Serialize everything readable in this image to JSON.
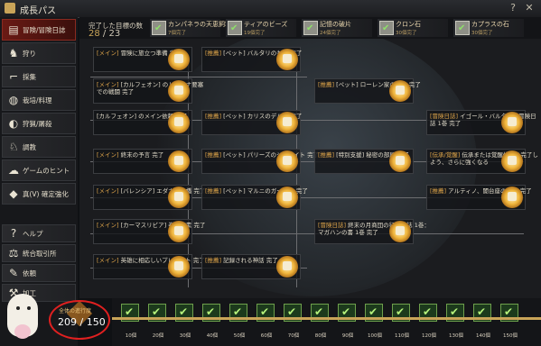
{
  "window": {
    "title": "成長パス"
  },
  "sidebar": {
    "items": [
      {
        "label": "冒険/冒険日誌",
        "icon": "book-icon"
      },
      {
        "label": "狩り",
        "icon": "boar-icon"
      },
      {
        "label": "採集",
        "icon": "hoe-icon"
      },
      {
        "label": "栽培/料理",
        "icon": "cooking-icon"
      },
      {
        "label": "狩猟/屠殺",
        "icon": "hunting-icon"
      },
      {
        "label": "調教",
        "icon": "horse-icon"
      },
      {
        "label": "ゲームのヒント",
        "icon": "hint-icon"
      },
      {
        "label": "真(V) 確定強化",
        "icon": "enhance-icon"
      }
    ],
    "extra": [
      {
        "label": "ヘルプ",
        "icon": "question-icon"
      },
      {
        "label": "統合取引所",
        "icon": "scale-icon"
      },
      {
        "label": "依頼",
        "icon": "scroll-icon"
      },
      {
        "label": "加工",
        "icon": "hammer-icon"
      }
    ]
  },
  "header": {
    "completed_label": "完了した目標の数",
    "completed_count": "28",
    "completed_total": "/ 23",
    "rewards": [
      {
        "name": "カンパネラの天恵飼料",
        "sub": "7個完了"
      },
      {
        "name": "ティアのビーズ",
        "sub": "19個完了"
      },
      {
        "name": "記憶の破片",
        "sub": "24個完了"
      },
      {
        "name": "クロン石",
        "sub": "30個完了"
      },
      {
        "name": "カプラスの石",
        "sub": "30個完了"
      }
    ]
  },
  "nodes": [
    {
      "tag": "[メイン]",
      "text": " 冒険に旅立つ準備 完了"
    },
    {
      "tag": "[推薦]",
      "text": " [ペット] バルタリのもの 完了"
    },
    {
      "tag": "[メイン]",
      "text": " [カルフェオン] のトリーナ要塞\nでの戦闘 完了"
    },
    {
      "tag": "[推薦]",
      "text": " [ペット] ローレン家のまる 完了"
    },
    {
      "tag": "",
      "text": "[カルフェオン] のメイン依頼 完了"
    },
    {
      "tag": "[推薦]",
      "text": " [ペット] カリスのデルペ 完了"
    },
    {
      "tag": "[冒険日誌]",
      "text": " イゴール・バルタリの冒険日\n誌 1巻 完了"
    },
    {
      "tag": "[メイン]",
      "text": " 終末の予言 完了"
    },
    {
      "tag": "[推薦]",
      "text": " [ペット] パリーズのジュナイト 完了"
    },
    {
      "tag": "[推薦]",
      "text": " [特別支援] 秘密の部屋 完了"
    },
    {
      "tag": "[伝承/覚醒]",
      "text": " 伝承または覚醒依頼を完了し\nよう、さらに強くなる"
    },
    {
      "tag": "[メイン]",
      "text": " [バレンシア] エダナの木橋 完了"
    },
    {
      "tag": "[推薦]",
      "text": " [ペット] マルニのガーガー 完了"
    },
    {
      "tag": "[推薦]",
      "text": " アルティノ、闇台座の世界 完了"
    },
    {
      "tag": "[メイン]",
      "text": " [カーマスリビア] 巻耕簡素 完了"
    },
    {
      "tag": "[冒険日誌]",
      "text": " 終末の月商団の行動日誌 1巻：\nマガハンの書 1巻 完了"
    },
    {
      "tag": "[メイン]",
      "text": " 英雄に相応しいプレゼント 完了"
    },
    {
      "tag": "[推薦]",
      "text": " 記録される神話 完了"
    }
  ],
  "total": {
    "label": "全体の進行度",
    "value": "209 / 150"
  },
  "milestones": [
    "10個",
    "20個",
    "30個",
    "40個",
    "50個",
    "60個",
    "70個",
    "80個",
    "90個",
    "100個",
    "110個",
    "120個",
    "130個",
    "140個",
    "150個"
  ]
}
